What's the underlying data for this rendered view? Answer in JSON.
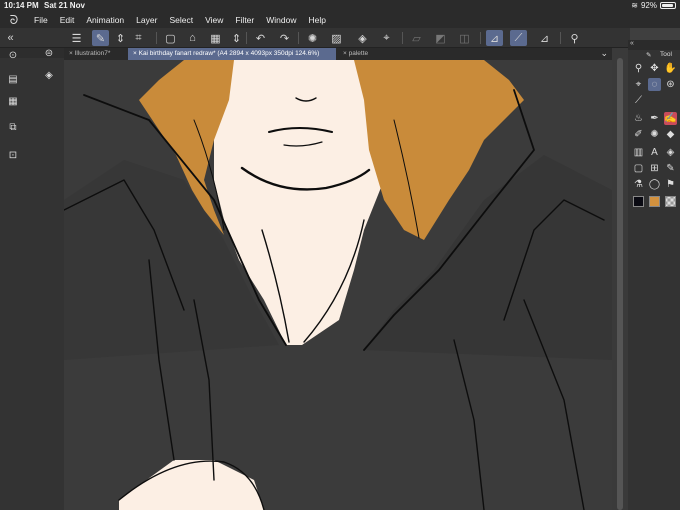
{
  "status": {
    "time": "10:14 PM",
    "date": "Sat 21 Nov",
    "battery": "92%",
    "battery_level": 0.92
  },
  "menu": {
    "items": [
      "File",
      "Edit",
      "Animation",
      "Layer",
      "Select",
      "View",
      "Filter",
      "Window",
      "Help"
    ]
  },
  "toolbar": {
    "buttons": [
      {
        "name": "menu-button",
        "glyph": "☰"
      },
      {
        "name": "edit-layer-button",
        "glyph": "✎",
        "active": true
      },
      {
        "name": "layer-stepper",
        "glyph": "⇕"
      },
      {
        "name": "reference-button",
        "glyph": "⌗"
      },
      {
        "name": "new-button",
        "glyph": "▢"
      },
      {
        "name": "open-button",
        "glyph": "⌂"
      },
      {
        "name": "save-button",
        "glyph": "▦"
      },
      {
        "name": "print-button",
        "glyph": "⎙"
      },
      {
        "name": "file-stepper",
        "glyph": "⇕"
      },
      {
        "name": "undo-button",
        "glyph": "↶"
      },
      {
        "name": "redo-button",
        "glyph": "↷"
      },
      {
        "name": "loading-button",
        "glyph": "✺"
      },
      {
        "name": "clear-button",
        "glyph": "▨"
      },
      {
        "name": "fill-button",
        "glyph": "◈"
      },
      {
        "name": "crop-button",
        "glyph": "⌖"
      },
      {
        "name": "selection-off-button",
        "glyph": "▱",
        "dim": true
      },
      {
        "name": "selection-invert-button",
        "glyph": "◩",
        "dim": true
      },
      {
        "name": "selection-clear-button",
        "glyph": "◫",
        "dim": true
      },
      {
        "name": "ruler-snap-button",
        "glyph": "⊿",
        "active": true
      },
      {
        "name": "special-ruler-button",
        "glyph": "⟋",
        "active": true
      },
      {
        "name": "grid-snap-button",
        "glyph": "⊿"
      },
      {
        "name": "assist-button",
        "glyph": "⚲"
      }
    ]
  },
  "tabs": [
    {
      "label": "Illustration7*"
    },
    {
      "label": "Kai birthday fanart redraw* (A4 2894 x 4093px 350dpi 124.6%)",
      "active": true
    },
    {
      "label": "palette"
    }
  ],
  "tooldock": {
    "title": "Tool"
  },
  "colors": {
    "main_color": "#0a0a12",
    "sub_color": "#d2913e",
    "transparent": "transparent",
    "accent": "#5b6a8f",
    "hair": "#c98b3a",
    "skin": "#fcefe4",
    "clothing": "#3a3a3a"
  }
}
